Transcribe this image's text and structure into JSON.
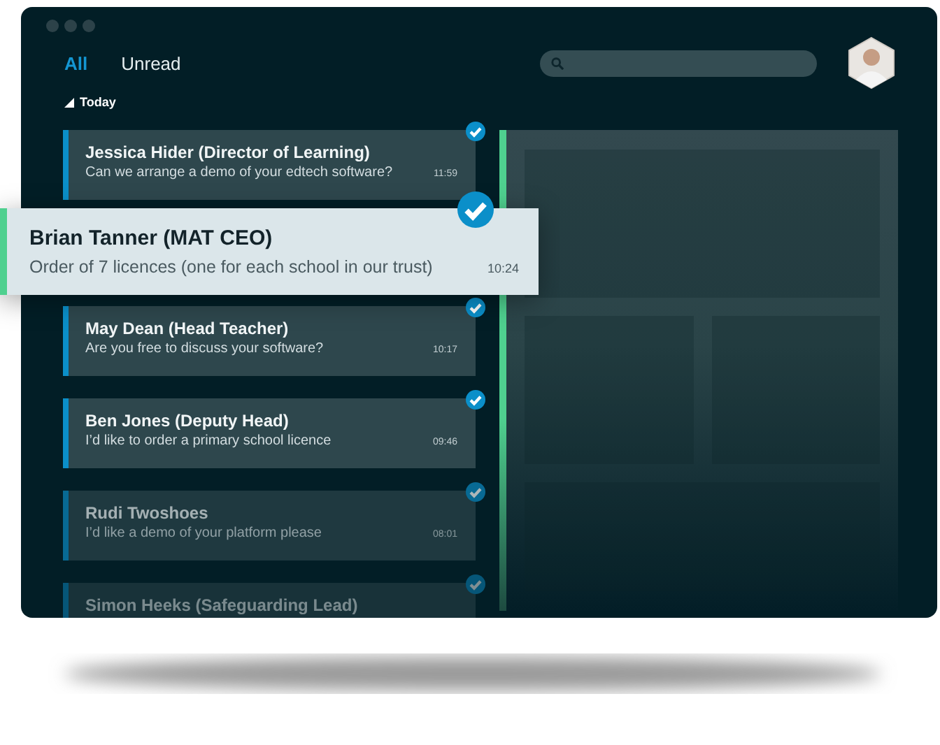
{
  "tabs": [
    {
      "label": "All",
      "selected": true
    },
    {
      "label": "Unread",
      "selected": false
    }
  ],
  "group": {
    "label": "Today",
    "expanded": true
  },
  "messages": [
    {
      "kind": "card",
      "name": "Jessica Hider (Director of Learning)",
      "preview": "Can we arrange a demo of your edtech software?",
      "time": "11:59"
    },
    {
      "kind": "raised",
      "name": "Brian Tanner (MAT CEO)",
      "preview": "Order of 7 licences (one for each school in our trust)",
      "time": "10:24"
    },
    {
      "kind": "card",
      "name": "May Dean (Head Teacher)",
      "preview": "Are you free to discuss your software?",
      "time": "10:17"
    },
    {
      "kind": "card",
      "name": "Ben Jones (Deputy Head)",
      "preview": "I’d like to order a primary school licence",
      "time": "09:46"
    },
    {
      "kind": "card",
      "name": "Rudi Twoshoes",
      "preview": "I’d like a demo of your platform please",
      "time": "08:01"
    },
    {
      "kind": "card",
      "name": "Simon Heeks (Safeguarding Lead)"
    }
  ]
}
